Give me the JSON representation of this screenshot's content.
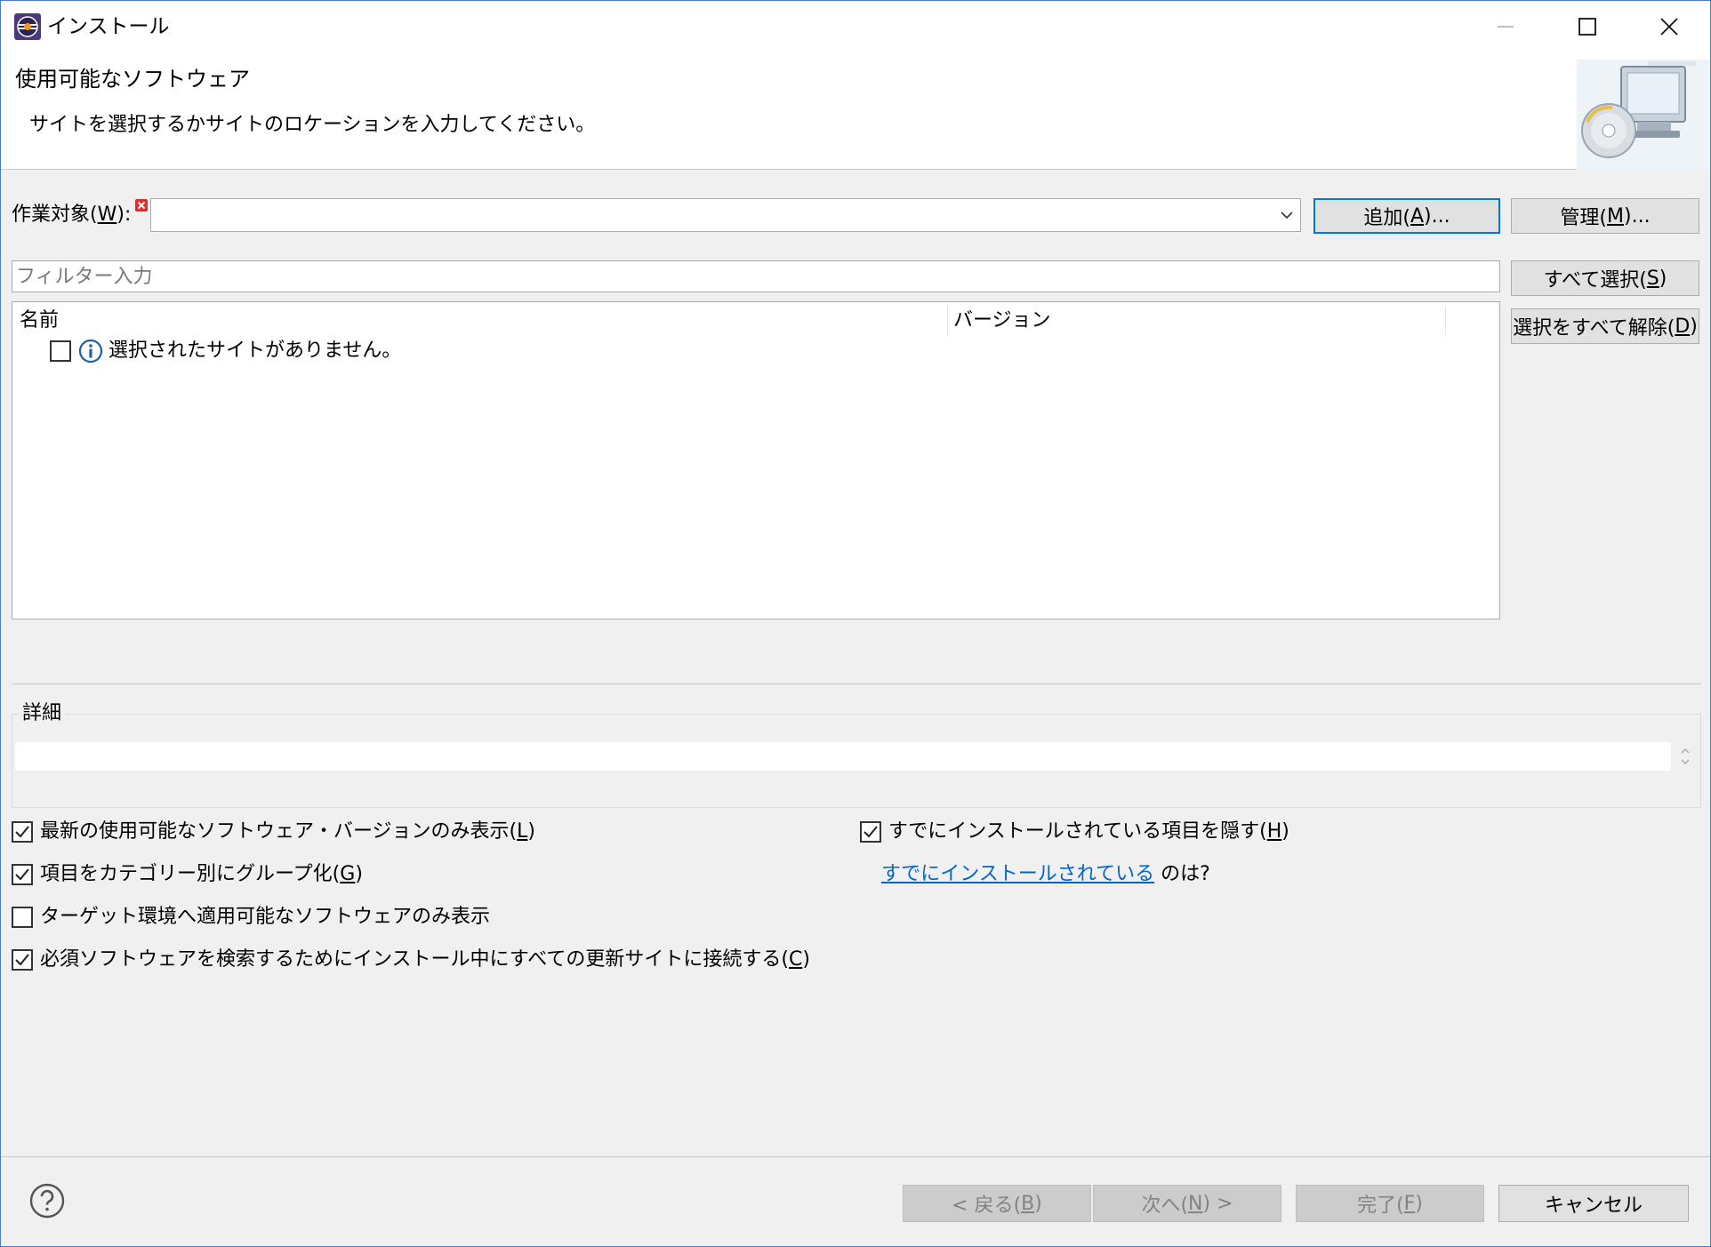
{
  "window": {
    "title": "インストール",
    "icon": "eclipse-app-icon",
    "controls": [
      "minimize-icon",
      "maximize-icon",
      "close-icon"
    ]
  },
  "header": {
    "title": "使用可能なソフトウェア",
    "description": "サイトを選択するかサイトのロケーションを入力してください。",
    "banner_icon": "install-cd-monitor-icon"
  },
  "work_with": {
    "label_prefix": "作業対象(",
    "label_mnemonic": "W",
    "label_suffix": "):",
    "value": "",
    "error_icon": "error-x-icon",
    "add_prefix": "追加(",
    "add_mnemonic": "A",
    "add_suffix": ")...",
    "manage_prefix": "管理(",
    "manage_mnemonic": "M",
    "manage_suffix": ")..."
  },
  "filter": {
    "placeholder": "フィルター入力"
  },
  "selection_buttons": {
    "select_all_prefix": "すべて選択(",
    "select_all_mnemonic": "S",
    "select_all_suffix": ")",
    "deselect_all_prefix": "選択をすべて解除(",
    "deselect_all_mnemonic": "D",
    "deselect_all_suffix": ")"
  },
  "tree": {
    "columns": [
      "名前",
      "バージョン"
    ],
    "rows": [
      {
        "checked": false,
        "icon": "info-icon",
        "label": "選択されたサイトがありません。"
      }
    ]
  },
  "details": {
    "label": "詳細",
    "text": ""
  },
  "options": {
    "left": [
      {
        "checked": true,
        "prefix": "最新の使用可能なソフトウェア・バージョンのみ表示(",
        "mnemonic": "L",
        "suffix": ")"
      },
      {
        "checked": true,
        "prefix": "項目をカテゴリー別にグループ化(",
        "mnemonic": "G",
        "suffix": ")"
      },
      {
        "checked": false,
        "prefix": "ターゲット環境へ適用可能なソフトウェアのみ表示",
        "mnemonic": "",
        "suffix": ""
      },
      {
        "checked": true,
        "prefix": "必須ソフトウェアを検索するためにインストール中にすべての更新サイトに接続する(",
        "mnemonic": "C",
        "suffix": ")"
      }
    ],
    "right": {
      "hide_installed": {
        "checked": true,
        "prefix": "すでにインストールされている項目を隠す(",
        "mnemonic": "H",
        "suffix": ")"
      },
      "already_installed_link": "すでにインストールされている",
      "already_installed_tail": "のは?"
    }
  },
  "footer": {
    "help_icon": "help-question-icon",
    "back_prefix": "< 戻る(",
    "back_mnemonic": "B",
    "back_suffix": ")",
    "next_prefix": "次へ(",
    "next_mnemonic": "N",
    "next_suffix": ") >",
    "finish_prefix": "完了(",
    "finish_mnemonic": "F",
    "finish_suffix": ")",
    "cancel": "キャンセル"
  }
}
